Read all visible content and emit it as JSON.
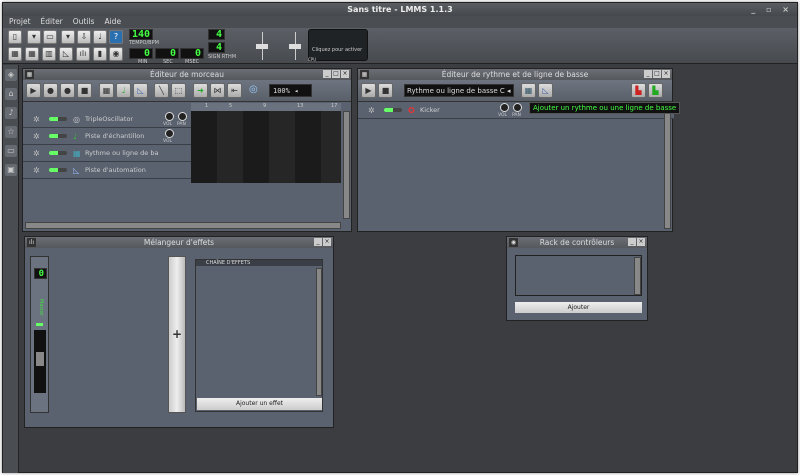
{
  "window": {
    "title": "Sans titre - LMMS 1.1.3",
    "controls": "_ ▫ ×"
  },
  "menu": [
    "Projet",
    "Éditer",
    "Outils",
    "Aide"
  ],
  "toolbar": {
    "tempo": "140",
    "tempo_label": "TEMPO/BPM",
    "min": "0",
    "sec": "0",
    "msec": "0",
    "min_label": "MIN",
    "sec_label": "SEC",
    "msec_label": "MSEC",
    "sig_num": "4",
    "sig_den": "4",
    "sig_label": "SIGN RTHM",
    "cpu_text": "Cliquez pour activer",
    "cpu_label": "CPU"
  },
  "song_editor": {
    "title": "Éditeur de morceau",
    "zoom": "100%",
    "ruler": [
      "1",
      "5",
      "9",
      "13",
      "17"
    ],
    "tracks": [
      {
        "name": "TripleOscillator",
        "icon": "oscillator-icon",
        "knobs": [
          "VOL",
          "PAN"
        ]
      },
      {
        "name": "Piste d'échantillon",
        "icon": "note-icon",
        "knobs": [
          "VOL"
        ]
      },
      {
        "name": "Rythme ou ligne de ba",
        "icon": "beat-icon",
        "knobs": []
      },
      {
        "name": "Piste d'automation",
        "icon": "automation-icon",
        "knobs": []
      }
    ]
  },
  "bb_editor": {
    "title": "Éditeur de rythme et de ligne de basse",
    "select": "Rythme ou ligne de basse C",
    "tooltip": "Ajouter un rythme ou une ligne de basse",
    "track": {
      "name": "Kicker",
      "knobs": [
        "VOL",
        "PAN"
      ]
    }
  },
  "fx_mixer": {
    "title": "Mélangeur d'effets",
    "channel_value": "0",
    "channel_name": "Master",
    "chain_title": "CHAÎNE D'EFFETS",
    "add_effect": "Ajouter un effet",
    "add_channel": "+"
  },
  "controller_rack": {
    "title": "Rack de contrôleurs",
    "add": "Ajouter"
  }
}
